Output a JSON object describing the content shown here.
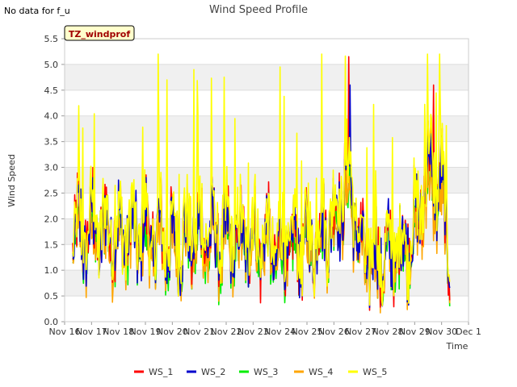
{
  "note": "No data for f_u",
  "chart_data": {
    "type": "line",
    "title": "Wind Speed Profile",
    "badge": "TZ_windprof",
    "xlabel": "Time",
    "ylabel": "Wind Speed",
    "ylim": [
      0.0,
      5.5
    ],
    "yticks": [
      "0.0",
      "0.5",
      "1.0",
      "1.5",
      "2.0",
      "2.5",
      "3.0",
      "3.5",
      "4.0",
      "4.5",
      "5.0",
      "5.5"
    ],
    "xticks": [
      "Nov 16",
      "Nov 17",
      "Nov 18",
      "Nov 19",
      "Nov 20",
      "Nov 21",
      "Nov 22",
      "Nov 23",
      "Nov 24",
      "Nov 25",
      "Nov 26",
      "Nov 27",
      "Nov 28",
      "Nov 29",
      "Nov 30",
      "Dec 1"
    ],
    "xlim_days": [
      16,
      31
    ],
    "data_span_days": [
      16.3,
      30.3
    ],
    "grid": true,
    "legend_position": "bottom",
    "series": [
      {
        "name": "WS_1",
        "color": "#ff0000"
      },
      {
        "name": "WS_2",
        "color": "#0000cc"
      },
      {
        "name": "WS_3",
        "color": "#00ee00"
      },
      {
        "name": "WS_4",
        "color": "#ffa500"
      },
      {
        "name": "WS_5",
        "color": "#ffff00"
      }
    ],
    "daily_mean": [
      [
        16.3,
        1.6
      ],
      [
        17,
        1.8
      ],
      [
        18,
        1.7
      ],
      [
        19,
        1.7
      ],
      [
        20,
        1.5
      ],
      [
        21,
        1.7
      ],
      [
        22,
        1.6
      ],
      [
        23,
        1.6
      ],
      [
        24,
        1.4
      ],
      [
        25,
        1.5
      ],
      [
        26,
        2.0
      ],
      [
        26.6,
        2.8
      ],
      [
        27,
        1.3
      ],
      [
        28,
        1.2
      ],
      [
        29,
        1.7
      ],
      [
        29.5,
        2.9
      ],
      [
        30,
        2.5
      ],
      [
        30.3,
        1.4
      ]
    ],
    "notable_peaks": [
      {
        "series": "WS_1",
        "day": 26.55,
        "value": 5.15
      },
      {
        "series": "WS_1",
        "day": 29.7,
        "value": 4.6
      },
      {
        "series": "WS_5",
        "day": 24.0,
        "value": 4.95
      },
      {
        "series": "WS_5",
        "day": 20.8,
        "value": 4.9
      },
      {
        "series": "WS_5",
        "day": 19.8,
        "value": 4.7
      },
      {
        "series": "WS_2",
        "day": 26.6,
        "value": 4.6
      }
    ]
  }
}
